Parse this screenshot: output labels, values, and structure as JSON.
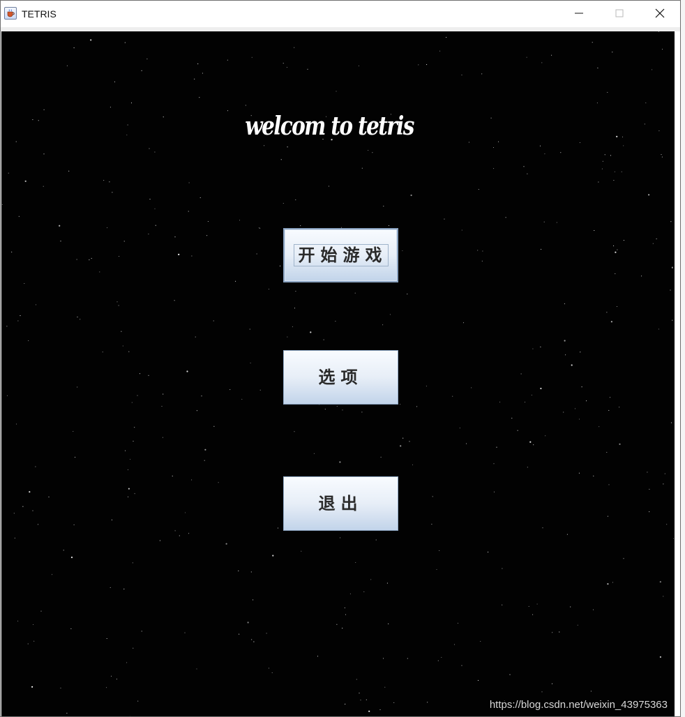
{
  "window": {
    "title": "TETRIS",
    "app_icon": "java-cup-icon",
    "controls": {
      "minimize": "minimize-icon",
      "maximize": "maximize-icon",
      "close": "close-icon"
    }
  },
  "screen": {
    "background_color": "#020202",
    "welcome_text": "welcom to tetris"
  },
  "menu": {
    "start_label": "开始游戏",
    "options_label": "选项",
    "exit_label": "退出"
  },
  "watermark": "https://blog.csdn.net/weixin_43975363"
}
